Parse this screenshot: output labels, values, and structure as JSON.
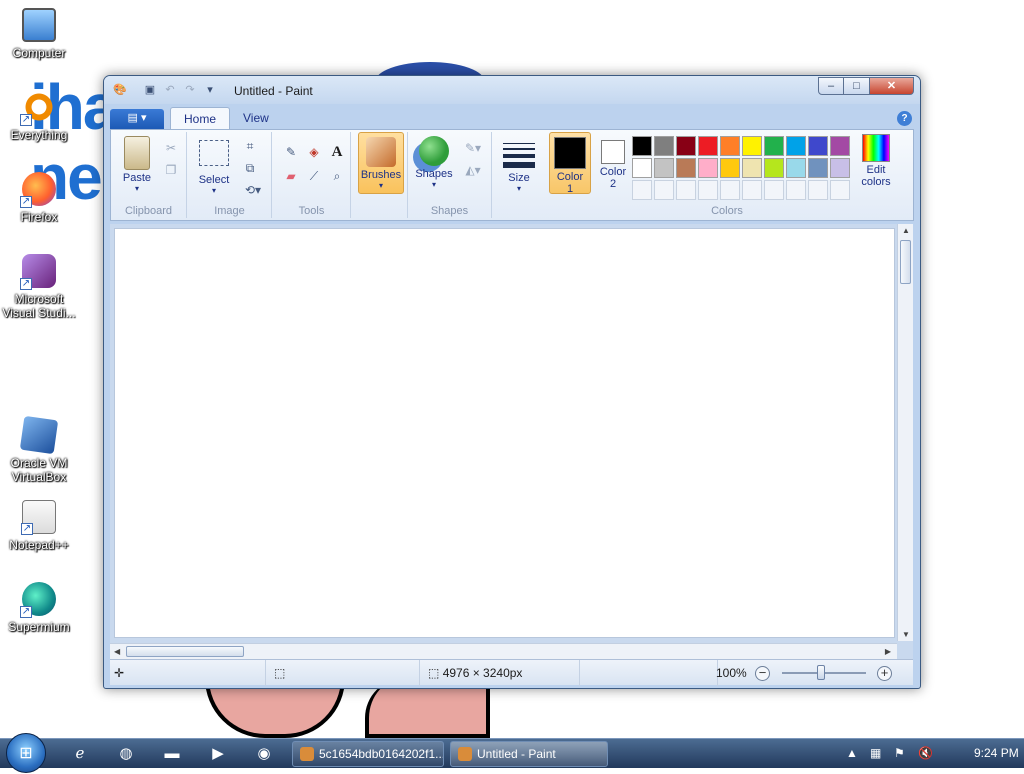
{
  "desktop": {
    "wallpaper_text": [
      "iha",
      "nen"
    ],
    "icons": [
      {
        "label": "Computer",
        "icon": "computer-icon"
      },
      {
        "label": "Everything",
        "icon": "search-app-icon"
      },
      {
        "label": "Firefox",
        "icon": "firefox-icon"
      },
      {
        "label": "Microsoft Visual Studi...",
        "icon": "visual-studio-icon"
      },
      {
        "label": "Oracle VM VirtualBox",
        "icon": "virtualbox-icon"
      },
      {
        "label": "Notepad++",
        "icon": "notepadpp-icon"
      },
      {
        "label": "Supermium",
        "icon": "browser-icon"
      }
    ]
  },
  "window": {
    "title": "Untitled - Paint",
    "controls": {
      "minimize": "–",
      "maximize": "□",
      "close": "✕"
    }
  },
  "ribbon": {
    "file_menu": "▤ ▾",
    "tabs": [
      {
        "label": "Home",
        "active": true
      },
      {
        "label": "View",
        "active": false
      }
    ],
    "help": "?",
    "groups": {
      "clipboard": {
        "label": "Clipboard",
        "paste": "Paste"
      },
      "image": {
        "label": "Image",
        "select": "Select"
      },
      "tools": {
        "label": "Tools"
      },
      "brushes": {
        "label": "Brushes"
      },
      "shapes": {
        "label": "Shapes",
        "button": "Shapes"
      },
      "size": {
        "label": "Size"
      },
      "colors": {
        "label": "Colors",
        "color1_label": "Color 1",
        "color1_value": "#000000",
        "color2_label": "Color 2",
        "color2_value": "#ffffff",
        "edit": "Edit colors",
        "palette_row1": [
          "#000000",
          "#7f7f7f",
          "#880015",
          "#ed1c24",
          "#ff7f27",
          "#fff200",
          "#22b14c",
          "#00a2e8",
          "#3f48cc",
          "#a349a4"
        ],
        "palette_row2": [
          "#ffffff",
          "#c3c3c3",
          "#b97a57",
          "#ffaec9",
          "#ffc90e",
          "#efe4b0",
          "#b5e61d",
          "#99d9ea",
          "#7092be",
          "#c8bfe7"
        ]
      }
    }
  },
  "statusbar": {
    "image_size": "4976 × 3240px",
    "zoom": "100%"
  },
  "taskbar": {
    "tasks": [
      {
        "label": "5c1654bdb0164202f1...",
        "active": false
      },
      {
        "label": "Untitled - Paint",
        "active": true
      }
    ],
    "clock": "9:24 PM"
  }
}
